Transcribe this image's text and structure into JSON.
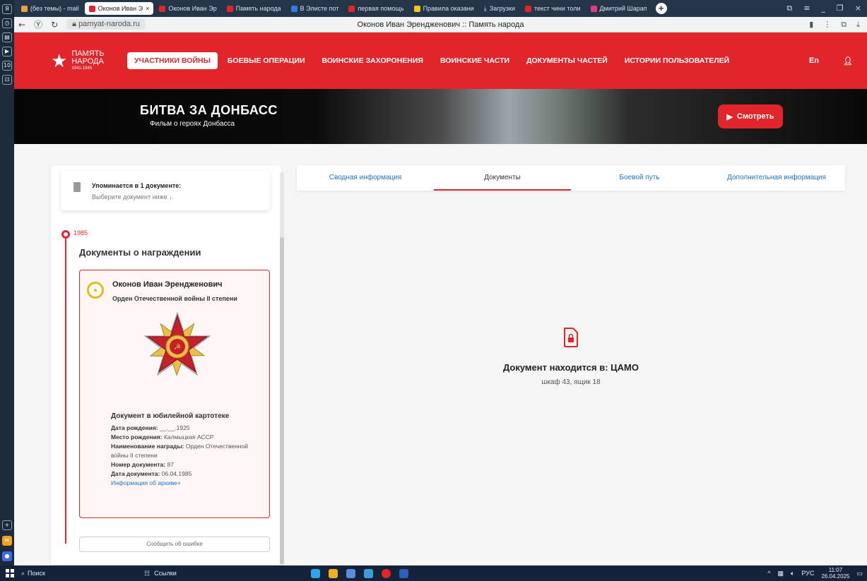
{
  "browser": {
    "tabs": [
      {
        "label": "(без темы) - mail",
        "color": "#e9a23b"
      },
      {
        "label": "Оконов Иван Э",
        "color": "#e1252b",
        "active": true
      },
      {
        "label": "Оконов Иван Эр",
        "color": "#e1252b"
      },
      {
        "label": "Память народа",
        "color": "#e1252b"
      },
      {
        "label": "В Элисте пот",
        "color": "#2f7be0"
      },
      {
        "label": "первая помощь",
        "color": "#e1252b"
      },
      {
        "label": "Правила оказани",
        "color": "#f3c517"
      },
      {
        "label": "Загрузки",
        "color": "#d7e1ec"
      },
      {
        "label": "текст чини толи",
        "color": "#e1252b"
      },
      {
        "label": "Дмитрий Шарап",
        "color": "#e03a8c"
      }
    ],
    "url": "pamyat-naroda.ru",
    "page_title": "Оконов Иван Эрендженович :: Память народа"
  },
  "site": {
    "logo_line1": "ПАМЯТЬ",
    "logo_line2": "НАРОДА",
    "logo_years": "1941-1945",
    "menu": [
      {
        "label": "УЧАСТНИКИ ВОЙНЫ",
        "active": true
      },
      {
        "label": "БОЕВЫЕ ОПЕРАЦИИ"
      },
      {
        "label": "ВОИНСКИЕ ЗАХОРОНЕНИЯ"
      },
      {
        "label": "ВОИНСКИЕ ЧАСТИ"
      },
      {
        "label": "ДОКУМЕНТЫ ЧАСТЕЙ"
      },
      {
        "label": "ИСТОРИИ ПОЛЬЗОВАТЕЛЕЙ"
      }
    ],
    "lang": "En"
  },
  "banner": {
    "title": "БИТВА ЗА ДОНБАСС",
    "subtitle": "Фильм о героях Донбасса",
    "watch_label": "Смотреть"
  },
  "sidebar": {
    "mention_title": "Упоминается в 1 документе:",
    "mention_hint": "Выберите документ ниже ↓",
    "year": "1985",
    "section_title": "Документы о награждении",
    "award": {
      "person": "Оконов Иван Эрендженович",
      "order": "Орден Отечественной войны II степени",
      "doc_heading": "Документ в юбилейной картотеке",
      "fields": [
        {
          "label": "Дата рождения:",
          "value": "__.__.1925"
        },
        {
          "label": "Место рождения:",
          "value": "Калмыцкая АССР"
        },
        {
          "label": "Наименование награды:",
          "value": "Орден Отечественной войны II степени"
        },
        {
          "label": "Номер документа:",
          "value": "87"
        },
        {
          "label": "Дата документа:",
          "value": "06.04.1985"
        }
      ],
      "archive_link": "Информация об архиве+"
    },
    "report_error": "Сообщить об ошибке"
  },
  "panel": {
    "tabs": [
      {
        "label": "Сводная информация"
      },
      {
        "label": "Документы",
        "active": true
      },
      {
        "label": "Боевой путь"
      },
      {
        "label": "Дополнительная информация"
      }
    ],
    "location_title": "Документ находится в: ЦАМО",
    "location_detail": "шкаф 43, ящик 18"
  },
  "taskbar": {
    "search_label": "Поиск",
    "links_label": "Ссылки",
    "lang": "РУС",
    "time": "11:07",
    "date": "26.04.2025"
  },
  "colors": {
    "brand_red": "#e1252b",
    "link_blue": "#1f73c8",
    "medal_gold": "#e8b820"
  }
}
